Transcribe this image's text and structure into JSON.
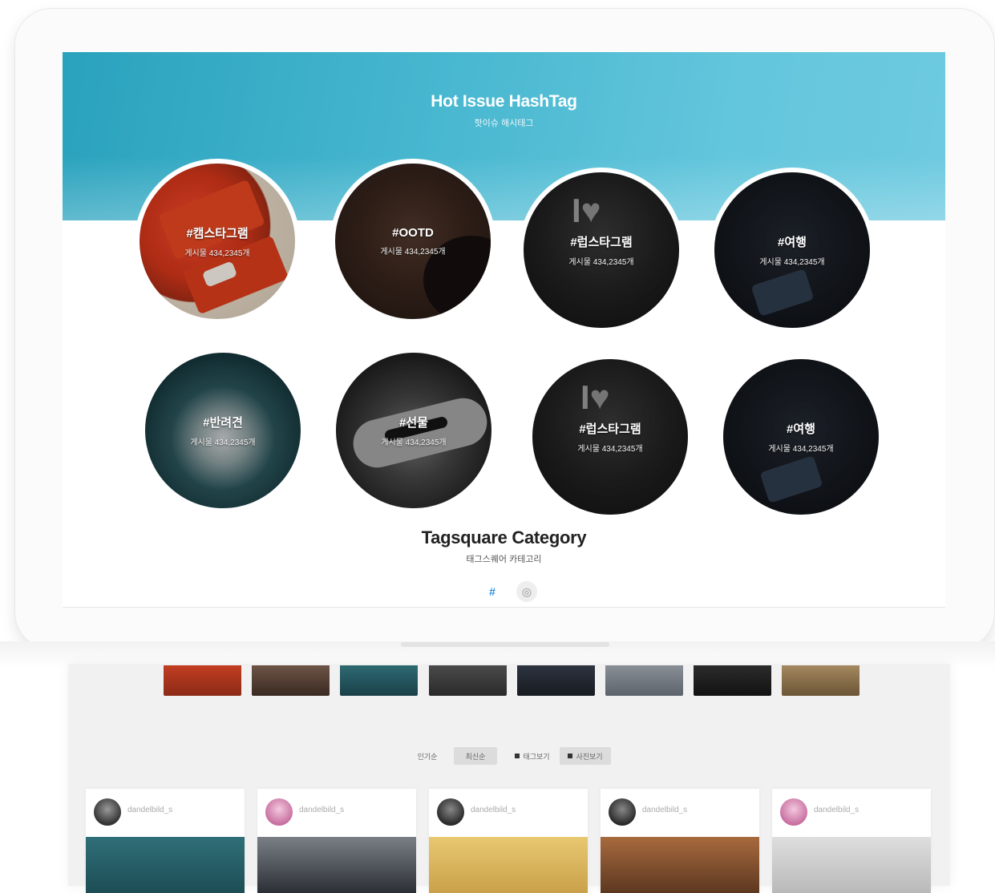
{
  "hero": {
    "title": "Hot Issue HashTag",
    "subtitle": "핫이슈 해시태그"
  },
  "hashtags": [
    {
      "tag": "#캠스타그램",
      "count": "게시물 434,2345개",
      "theme": "car"
    },
    {
      "tag": "#OOTD",
      "count": "게시물 434,2345개",
      "theme": "ootd"
    },
    {
      "tag": "#럽스타그램",
      "count": "게시물 434,2345개",
      "theme": "insta"
    },
    {
      "tag": "#여행",
      "count": "게시물 434,2345개",
      "theme": "travel"
    },
    {
      "tag": "#반려견",
      "count": "게시물 434,2345개",
      "theme": "dog"
    },
    {
      "tag": "#선물",
      "count": "게시물 434,2345개",
      "theme": "shoe"
    },
    {
      "tag": "#럽스타그램",
      "count": "게시물 434,2345개",
      "theme": "insta"
    },
    {
      "tag": "#여행",
      "count": "게시물 434,2345개",
      "theme": "travel"
    }
  ],
  "category": {
    "title": "Tagsquare Category",
    "subtitle": "태그스퀘어 카테고리",
    "buttons": [
      {
        "label": "#",
        "icon": "hash-icon"
      },
      {
        "label": "◎",
        "icon": "circle-icon"
      }
    ]
  },
  "lower": {
    "controls": [
      {
        "label": "인기순"
      },
      {
        "label": "최신순"
      },
      {
        "label": "태그보기"
      },
      {
        "label": "사진보기"
      }
    ],
    "users": [
      {
        "name": "dandelbild_s"
      },
      {
        "name": "dandelbild_s"
      },
      {
        "name": "dandelbild_s"
      },
      {
        "name": "dandelbild_s"
      },
      {
        "name": "dandelbild_s"
      }
    ]
  },
  "colors": {
    "banner": "#46b6cf",
    "accent": "#2b8fe0"
  }
}
